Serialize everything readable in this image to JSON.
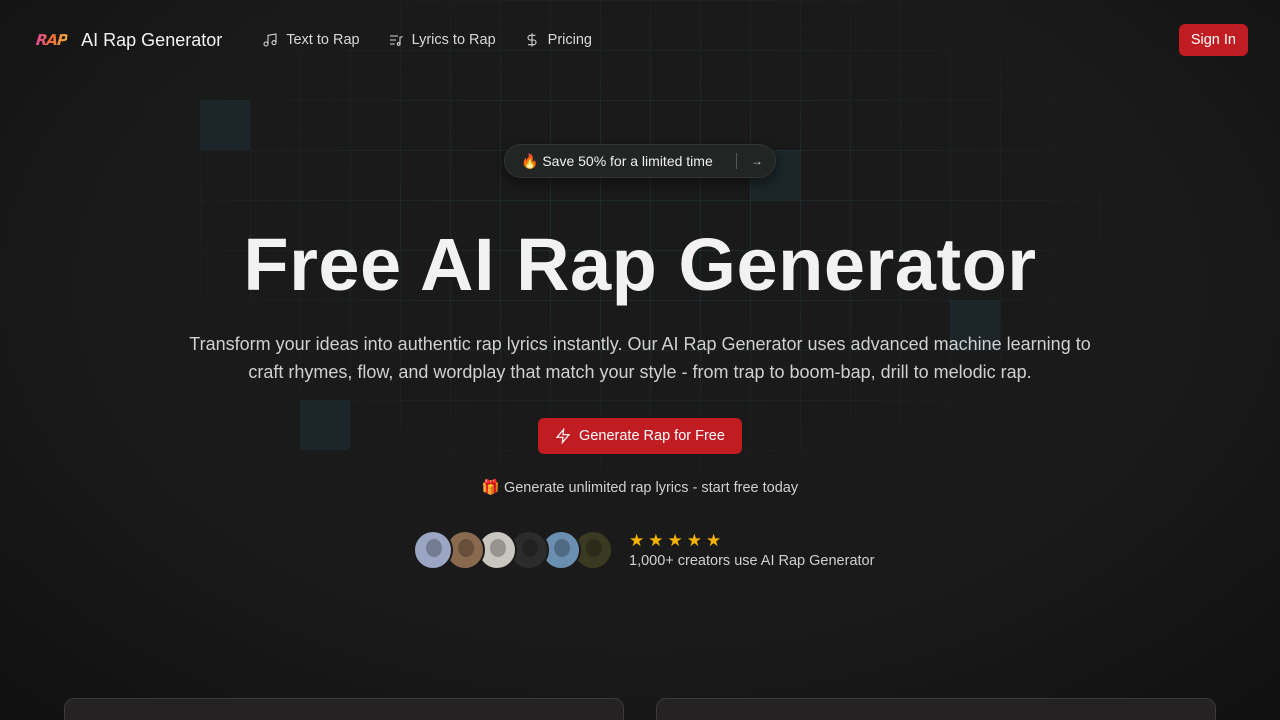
{
  "brand": {
    "logo_text": "RAP",
    "name": "AI Rap Generator"
  },
  "nav": {
    "items": [
      {
        "label": "Text to Rap",
        "icon": "music-note-icon"
      },
      {
        "label": "Lyrics to Rap",
        "icon": "list-music-icon"
      },
      {
        "label": "Pricing",
        "icon": "dollar-icon"
      }
    ],
    "signin_label": "Sign In"
  },
  "hero": {
    "promo_text": "🔥 Save 50% for a limited time",
    "promo_arrow": "→",
    "title": "Free AI Rap Generator",
    "subtitle": "Transform your ideas into authentic rap lyrics instantly. Our AI Rap Generator uses advanced machine learning to craft rhymes, flow, and wordplay that match your style - from trap to boom-bap, drill to melodic rap.",
    "cta_label": "Generate Rap for Free",
    "cta_icon": "zap-icon",
    "note": "🎁 Generate unlimited rap lyrics - start free today"
  },
  "social_proof": {
    "rating_stars": 5,
    "text": "1,000+ creators use AI Rap Generator",
    "avatars": [
      {
        "color": "#9aa6c4"
      },
      {
        "color": "#8a6a4e"
      },
      {
        "color": "#c8c6be"
      },
      {
        "color": "#2c2c2c"
      },
      {
        "color": "#6a8fb0"
      },
      {
        "color": "#3a3a22"
      }
    ]
  },
  "colors": {
    "accent": "#c01c22",
    "background": "#1a1a1a",
    "star": "#f5b400"
  }
}
